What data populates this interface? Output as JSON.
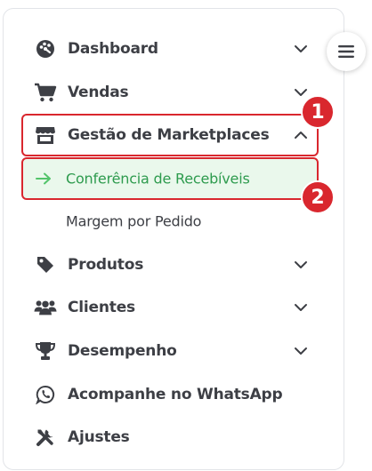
{
  "colors": {
    "text": "#3d3f45",
    "active_text": "#2e9b4e",
    "active_bg": "#eaf8ec",
    "highlight": "#d9272e"
  },
  "toggle": {
    "icon": "menu-icon"
  },
  "menu": {
    "dashboard": {
      "label": "Dashboard",
      "icon": "palette-icon"
    },
    "vendas": {
      "label": "Vendas",
      "icon": "cart-icon"
    },
    "gestao": {
      "label": "Gestão de Marketplaces",
      "icon": "store-icon",
      "expanded": true
    },
    "conferencia": {
      "label": "Conferência de Recebíveis",
      "icon": "arrow-right-icon",
      "active": true
    },
    "margem": {
      "label": "Margem por Pedido"
    },
    "produtos": {
      "label": "Produtos",
      "icon": "tag-icon"
    },
    "clientes": {
      "label": "Clientes",
      "icon": "users-icon"
    },
    "desempenho": {
      "label": "Desempenho",
      "icon": "trophy-icon"
    },
    "whatsapp": {
      "label": "Acompanhe no WhatsApp",
      "icon": "whatsapp-icon"
    },
    "ajustes": {
      "label": "Ajustes",
      "icon": "tools-icon"
    }
  },
  "annotations": {
    "badge1": "1",
    "badge2": "2"
  }
}
